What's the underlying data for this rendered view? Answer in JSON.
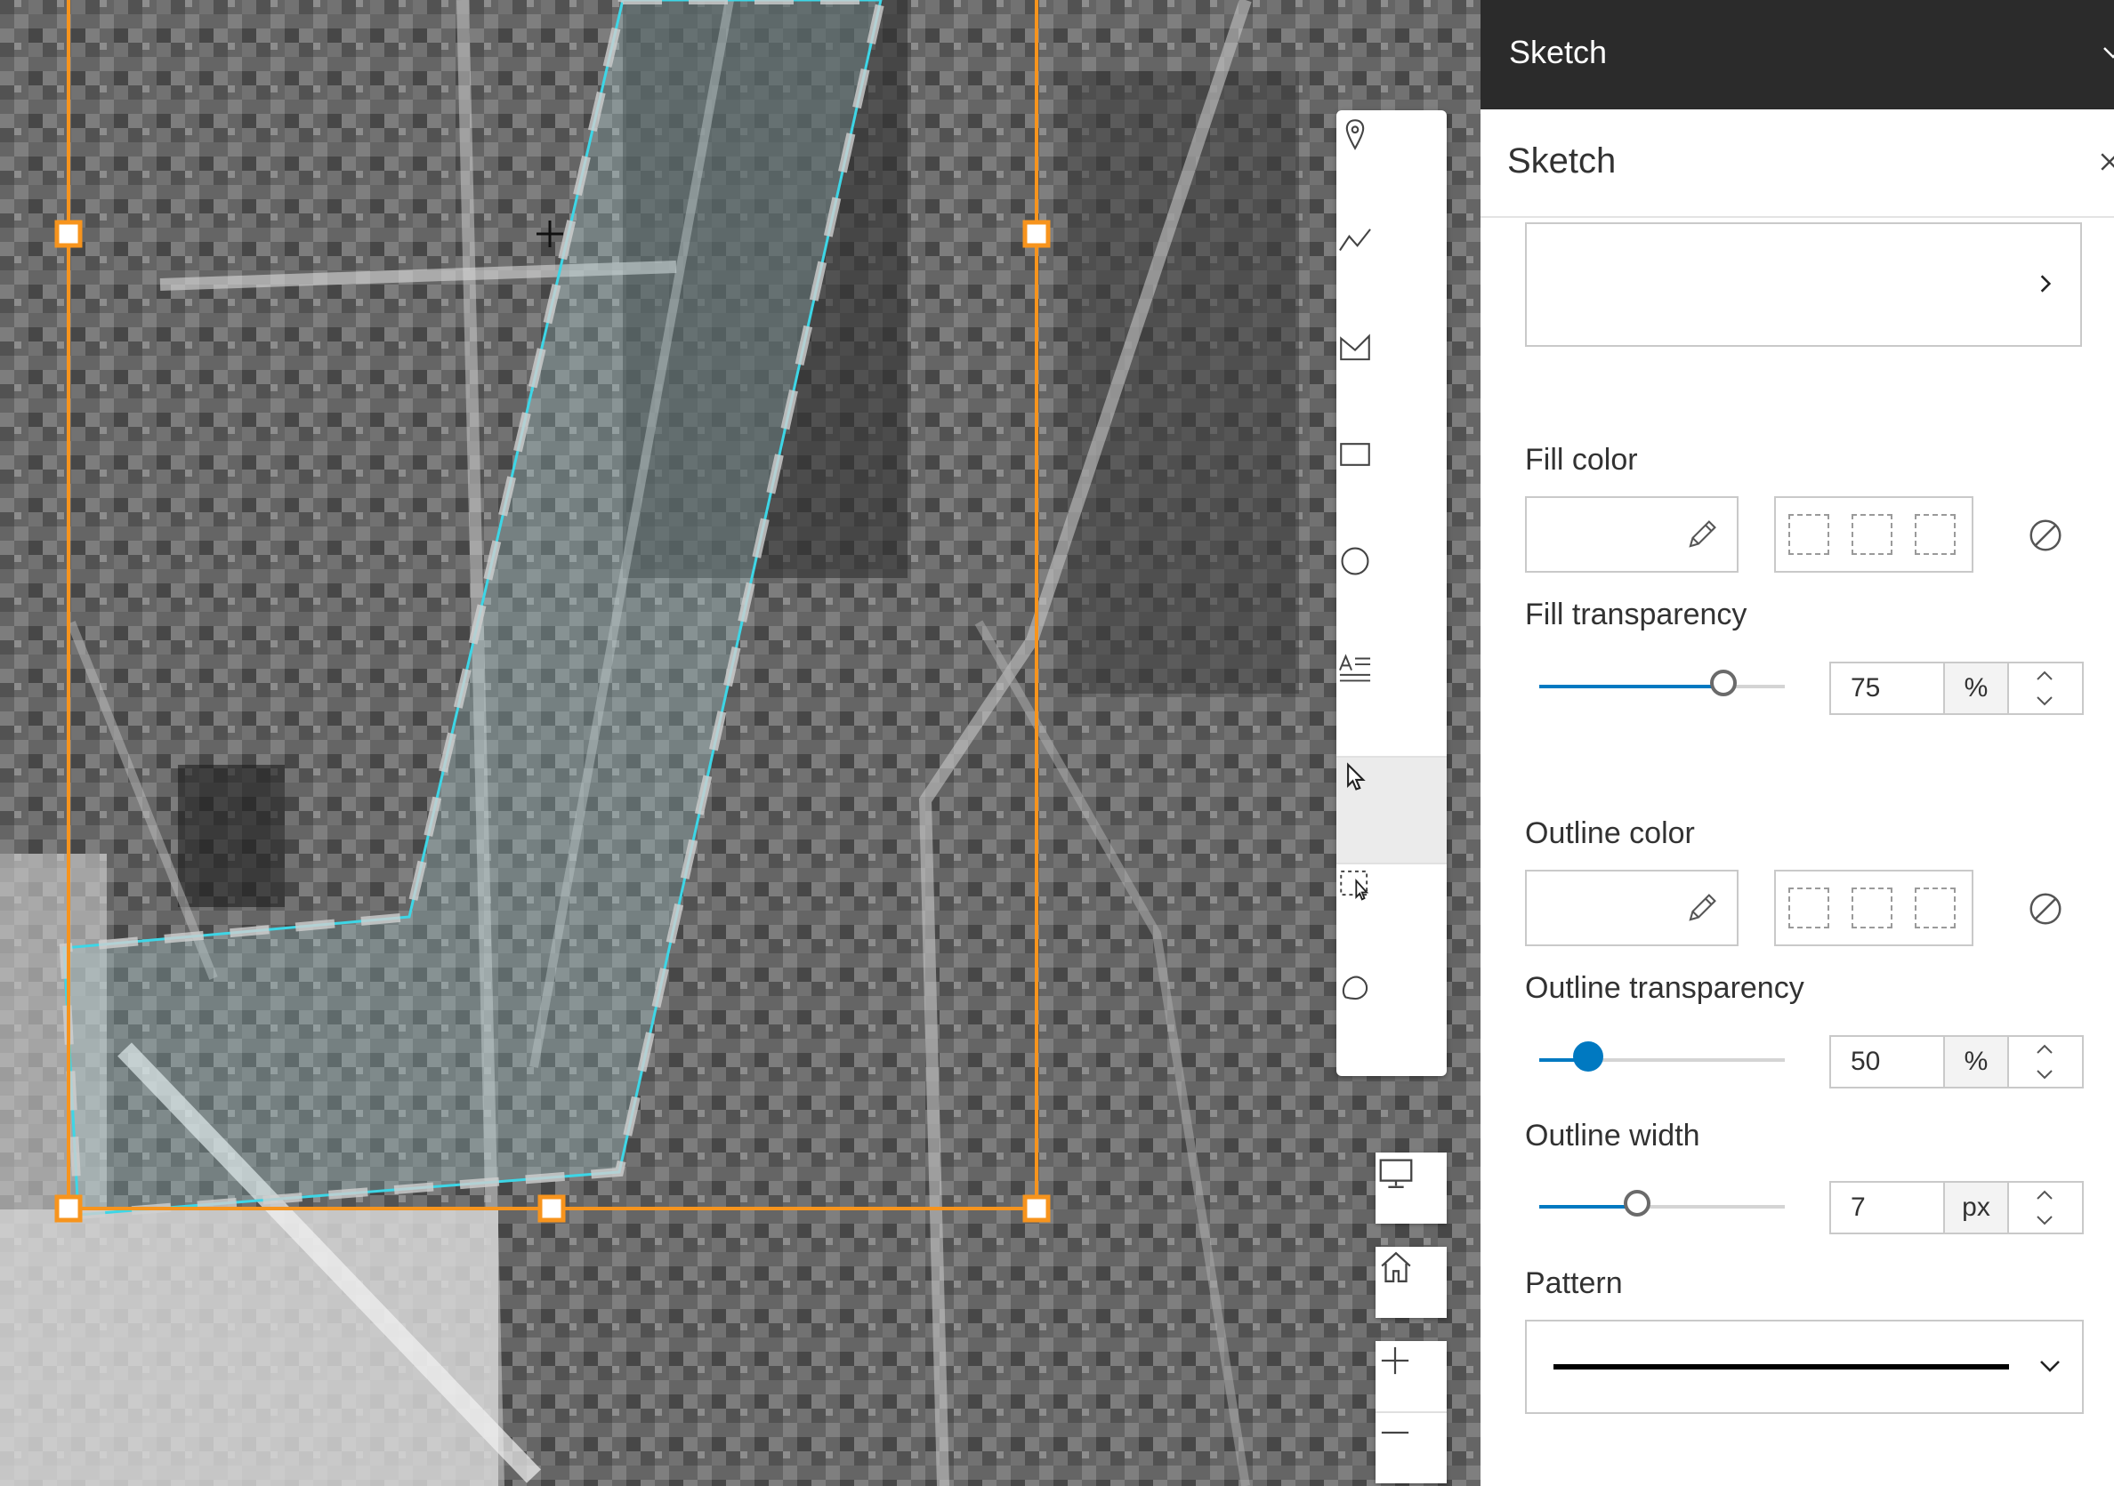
{
  "panel": {
    "header_title": "Sketch",
    "widget_title": "Sketch"
  },
  "fill": {
    "color_label": "Fill color",
    "transparency_label": "Fill transparency",
    "transparency_value": "75",
    "transparency_unit": "%",
    "transparency_fraction": 0.75
  },
  "outline": {
    "color_label": "Outline color",
    "transparency_label": "Outline transparency",
    "transparency_value": "50",
    "transparency_unit": "%",
    "transparency_fraction": 0.2,
    "width_label": "Outline width",
    "width_value": "7",
    "width_unit": "px",
    "width_fraction": 0.4
  },
  "pattern": {
    "label": "Pattern",
    "selected": "solid-line"
  },
  "toolbar": {
    "tools": [
      "point-icon",
      "polyline-icon",
      "polygon-icon",
      "rectangle-icon",
      "circle-icon",
      "text-icon",
      "select-icon",
      "rectangle-select-icon",
      "lasso-select-icon"
    ],
    "active_tool": "select-icon"
  },
  "colors": {
    "accent": "#0079c1",
    "selection_box": "#f7941d",
    "sketch_outline": "#3dd6e6",
    "header_bg": "#2b2b2b"
  }
}
